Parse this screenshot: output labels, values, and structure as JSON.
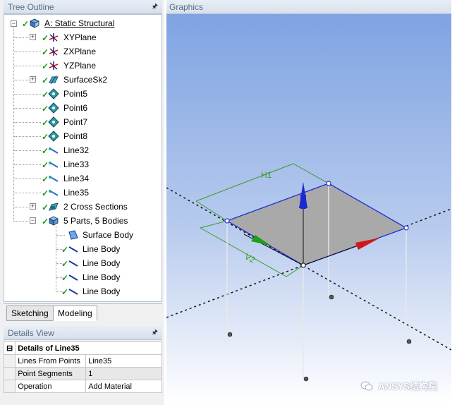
{
  "tree_outline": {
    "title": "Tree Outline",
    "pin_icon": "pin-icon",
    "root": "A: Static Structural",
    "items": [
      {
        "label": "XYPlane",
        "icon": "plane-axes-icon",
        "expandable": true
      },
      {
        "label": "ZXPlane",
        "icon": "plane-axes-icon",
        "expandable": false
      },
      {
        "label": "YZPlane",
        "icon": "plane-axes-icon",
        "expandable": false
      },
      {
        "label": "SurfaceSk2",
        "icon": "surface-sketch-icon",
        "expandable": true
      },
      {
        "label": "Point5",
        "icon": "point-icon",
        "expandable": false
      },
      {
        "label": "Point6",
        "icon": "point-icon",
        "expandable": false
      },
      {
        "label": "Point7",
        "icon": "point-icon",
        "expandable": false
      },
      {
        "label": "Point8",
        "icon": "point-icon",
        "expandable": false
      },
      {
        "label": "Line32",
        "icon": "line-icon",
        "expandable": false
      },
      {
        "label": "Line33",
        "icon": "line-icon",
        "expandable": false
      },
      {
        "label": "Line34",
        "icon": "line-icon",
        "expandable": false
      },
      {
        "label": "Line35",
        "icon": "line-icon",
        "expandable": false
      },
      {
        "label": "2 Cross Sections",
        "icon": "cross-section-icon",
        "expandable": true
      },
      {
        "label": "5 Parts, 5 Bodies",
        "icon": "parts-icon",
        "expandable": true,
        "expanded": true
      }
    ],
    "bodies": [
      {
        "label": "Surface Body",
        "icon": "surface-body-icon"
      },
      {
        "label": "Line Body",
        "icon": "line-body-icon"
      },
      {
        "label": "Line Body",
        "icon": "line-body-icon"
      },
      {
        "label": "Line Body",
        "icon": "line-body-icon"
      },
      {
        "label": "Line Body",
        "icon": "line-body-icon"
      }
    ]
  },
  "tabs": {
    "sketching": "Sketching",
    "modeling": "Modeling",
    "active": "Modeling"
  },
  "details": {
    "title": "Details View",
    "header": "Details of Line35",
    "rows": [
      {
        "key": "Lines From Points",
        "value": "Line35"
      },
      {
        "key": "Point Segments",
        "value": "1"
      },
      {
        "key": "Operation",
        "value": "Add Material"
      }
    ]
  },
  "graphics": {
    "title": "Graphics",
    "dim_h1": "H1",
    "dim_v2": "V2",
    "watermark": "ANSYS结构院",
    "colors": {
      "background_top": "#7fa3e2",
      "surface": "#a9a9a9",
      "edge": "#1f2fd0",
      "dimension": "#3a9a2a",
      "axis_x": "#d01818",
      "axis_y": "#1a2ad0",
      "axis_z": "#1aa01a"
    }
  }
}
